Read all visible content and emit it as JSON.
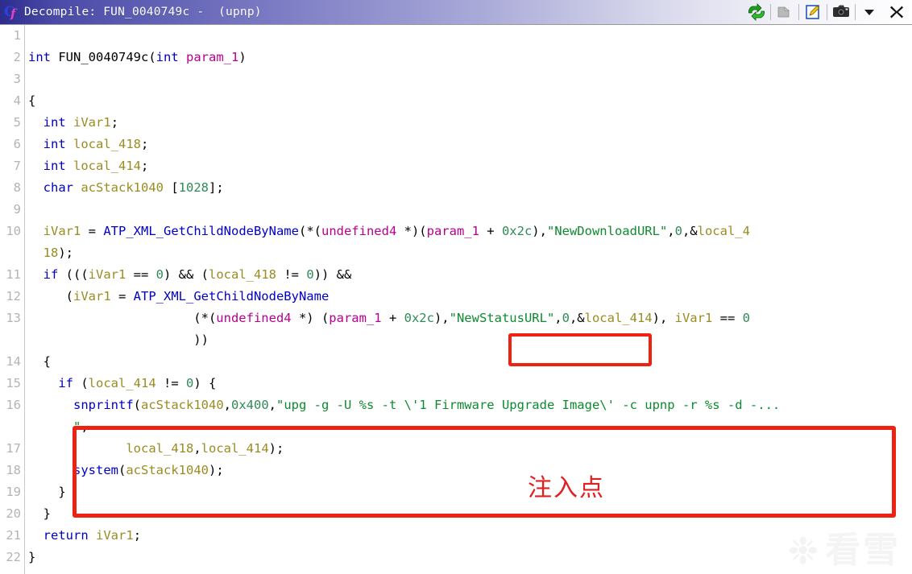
{
  "window": {
    "title": "Decompile: FUN_0040749c -  (upnp)",
    "icon_name": "ghidra-decompiler-icon",
    "toolbar": [
      {
        "name": "refresh-button",
        "label": "Refresh",
        "enabled": true
      },
      {
        "name": "copy-button",
        "label": "Copy",
        "enabled": false
      },
      {
        "name": "edit-button",
        "label": "Edit Function",
        "enabled": true
      },
      {
        "name": "snapshot-button",
        "label": "Snapshot",
        "enabled": true
      },
      {
        "name": "menu-button",
        "label": "Menu",
        "enabled": true
      },
      {
        "name": "close-button",
        "label": "Close",
        "enabled": true
      }
    ]
  },
  "colors": {
    "keyword": "#0000c0",
    "function": "#0000c8",
    "variable": "#9a8c22",
    "parameter": "#b8008f",
    "string": "#0e8a30",
    "number": "#2e8b57",
    "annotation": "#ee2211",
    "gutter_text": "#b4b4b4",
    "titlebar_start": "#2c2c8c",
    "titlebar_end": "#ffffff"
  },
  "code": {
    "lines": [
      {
        "n": "1",
        "tokens": []
      },
      {
        "n": "2",
        "tokens": [
          {
            "t": "int",
            "c": "kw"
          },
          {
            "t": " ",
            "c": "pl"
          },
          {
            "t": "FUN_0040749c",
            "c": "pl"
          },
          {
            "t": "(",
            "c": "pl"
          },
          {
            "t": "int",
            "c": "kw"
          },
          {
            "t": " ",
            "c": "pl"
          },
          {
            "t": "param_1",
            "c": "par"
          },
          {
            "t": ")",
            "c": "pl"
          }
        ]
      },
      {
        "n": "3",
        "tokens": []
      },
      {
        "n": "4",
        "tokens": [
          {
            "t": "{",
            "c": "pl"
          }
        ]
      },
      {
        "n": "5",
        "tokens": [
          {
            "t": "  ",
            "c": "pl"
          },
          {
            "t": "int",
            "c": "kw"
          },
          {
            "t": " ",
            "c": "pl"
          },
          {
            "t": "iVar1",
            "c": "var"
          },
          {
            "t": ";",
            "c": "pl"
          }
        ]
      },
      {
        "n": "6",
        "tokens": [
          {
            "t": "  ",
            "c": "pl"
          },
          {
            "t": "int",
            "c": "kw"
          },
          {
            "t": " ",
            "c": "pl"
          },
          {
            "t": "local_418",
            "c": "var"
          },
          {
            "t": ";",
            "c": "pl"
          }
        ]
      },
      {
        "n": "7",
        "tokens": [
          {
            "t": "  ",
            "c": "pl"
          },
          {
            "t": "int",
            "c": "kw"
          },
          {
            "t": " ",
            "c": "pl"
          },
          {
            "t": "local_414",
            "c": "var"
          },
          {
            "t": ";",
            "c": "pl"
          }
        ]
      },
      {
        "n": "8",
        "tokens": [
          {
            "t": "  ",
            "c": "pl"
          },
          {
            "t": "char",
            "c": "kw"
          },
          {
            "t": " ",
            "c": "pl"
          },
          {
            "t": "acStack1040",
            "c": "var"
          },
          {
            "t": " [",
            "c": "pl"
          },
          {
            "t": "1028",
            "c": "num"
          },
          {
            "t": "];",
            "c": "pl"
          }
        ]
      },
      {
        "n": "9",
        "tokens": []
      },
      {
        "n": "10",
        "tokens": [
          {
            "t": "  ",
            "c": "pl"
          },
          {
            "t": "iVar1",
            "c": "var"
          },
          {
            "t": " = ",
            "c": "pl"
          },
          {
            "t": "ATP_XML_GetChildNodeByName",
            "c": "fn"
          },
          {
            "t": "(*(",
            "c": "pl"
          },
          {
            "t": "undefined4",
            "c": "typ"
          },
          {
            "t": " *)(",
            "c": "pl"
          },
          {
            "t": "param_1",
            "c": "par"
          },
          {
            "t": " + ",
            "c": "pl"
          },
          {
            "t": "0x2c",
            "c": "num"
          },
          {
            "t": "),",
            "c": "pl"
          },
          {
            "t": "\"NewDownloadURL\"",
            "c": "str"
          },
          {
            "t": ",",
            "c": "pl"
          },
          {
            "t": "0",
            "c": "num"
          },
          {
            "t": ",&",
            "c": "pl"
          },
          {
            "t": "local_4",
            "c": "var"
          }
        ]
      },
      {
        "n": "",
        "tokens": [
          {
            "t": "  ",
            "c": "pl"
          },
          {
            "t": "18",
            "c": "var"
          },
          {
            "t": ");",
            "c": "pl"
          }
        ]
      },
      {
        "n": "11",
        "tokens": [
          {
            "t": "  ",
            "c": "pl"
          },
          {
            "t": "if",
            "c": "kw"
          },
          {
            "t": " (((",
            "c": "pl"
          },
          {
            "t": "iVar1",
            "c": "var"
          },
          {
            "t": " == ",
            "c": "pl"
          },
          {
            "t": "0",
            "c": "num"
          },
          {
            "t": ") && (",
            "c": "pl"
          },
          {
            "t": "local_418",
            "c": "var"
          },
          {
            "t": " != ",
            "c": "pl"
          },
          {
            "t": "0",
            "c": "num"
          },
          {
            "t": ")) &&",
            "c": "pl"
          }
        ]
      },
      {
        "n": "12",
        "tokens": [
          {
            "t": "     (",
            "c": "pl"
          },
          {
            "t": "iVar1",
            "c": "var"
          },
          {
            "t": " = ",
            "c": "pl"
          },
          {
            "t": "ATP_XML_GetChildNodeByName",
            "c": "fn"
          }
        ]
      },
      {
        "n": "13",
        "tokens": [
          {
            "t": "                      (*(",
            "c": "pl"
          },
          {
            "t": "undefined4",
            "c": "typ"
          },
          {
            "t": " *) (",
            "c": "pl"
          },
          {
            "t": "param_1",
            "c": "par"
          },
          {
            "t": " + ",
            "c": "pl"
          },
          {
            "t": "0x2c",
            "c": "num"
          },
          {
            "t": "),",
            "c": "pl"
          },
          {
            "t": "\"NewStatusURL\"",
            "c": "str"
          },
          {
            "t": ",",
            "c": "pl"
          },
          {
            "t": "0",
            "c": "num"
          },
          {
            "t": ",&",
            "c": "pl"
          },
          {
            "t": "local_414",
            "c": "var"
          },
          {
            "t": "), ",
            "c": "pl"
          },
          {
            "t": "iVar1",
            "c": "var"
          },
          {
            "t": " == ",
            "c": "pl"
          },
          {
            "t": "0",
            "c": "num"
          }
        ]
      },
      {
        "n": "",
        "tokens": [
          {
            "t": "                      ))",
            "c": "pl"
          }
        ]
      },
      {
        "n": "14",
        "tokens": [
          {
            "t": "  {",
            "c": "pl"
          }
        ]
      },
      {
        "n": "15",
        "tokens": [
          {
            "t": "    ",
            "c": "pl"
          },
          {
            "t": "if",
            "c": "kw"
          },
          {
            "t": " (",
            "c": "pl"
          },
          {
            "t": "local_414",
            "c": "var"
          },
          {
            "t": " != ",
            "c": "pl"
          },
          {
            "t": "0",
            "c": "num"
          },
          {
            "t": ") {",
            "c": "pl"
          }
        ]
      },
      {
        "n": "16",
        "tokens": [
          {
            "t": "      ",
            "c": "pl"
          },
          {
            "t": "snprintf",
            "c": "fn"
          },
          {
            "t": "(",
            "c": "pl"
          },
          {
            "t": "acStack1040",
            "c": "var"
          },
          {
            "t": ",",
            "c": "pl"
          },
          {
            "t": "0x400",
            "c": "num"
          },
          {
            "t": ",",
            "c": "pl"
          },
          {
            "t": "\"upg -g -U %s -t \\'1 Firmware Upgrade Image\\' -c upnp -r %s -d -...",
            "c": "str"
          }
        ]
      },
      {
        "n": "",
        "tokens": [
          {
            "t": "      ",
            "c": "pl"
          },
          {
            "t": "\"",
            "c": "str"
          },
          {
            "t": ",",
            "c": "pl"
          }
        ]
      },
      {
        "n": "17",
        "tokens": [
          {
            "t": "             ",
            "c": "pl"
          },
          {
            "t": "local_418",
            "c": "var"
          },
          {
            "t": ",",
            "c": "pl"
          },
          {
            "t": "local_414",
            "c": "var"
          },
          {
            "t": ");",
            "c": "pl"
          }
        ]
      },
      {
        "n": "18",
        "tokens": [
          {
            "t": "      ",
            "c": "pl"
          },
          {
            "t": "system",
            "c": "fn"
          },
          {
            "t": "(",
            "c": "pl"
          },
          {
            "t": "acStack1040",
            "c": "var"
          },
          {
            "t": ");",
            "c": "pl"
          }
        ]
      },
      {
        "n": "19",
        "tokens": [
          {
            "t": "    }",
            "c": "pl"
          }
        ]
      },
      {
        "n": "20",
        "tokens": [
          {
            "t": "  }",
            "c": "pl"
          }
        ]
      },
      {
        "n": "21",
        "tokens": [
          {
            "t": "  ",
            "c": "pl"
          },
          {
            "t": "return",
            "c": "kw"
          },
          {
            "t": " ",
            "c": "pl"
          },
          {
            "t": "iVar1",
            "c": "var"
          },
          {
            "t": ";",
            "c": "pl"
          }
        ]
      },
      {
        "n": "22",
        "tokens": [
          {
            "t": "}",
            "c": "pl"
          }
        ]
      }
    ]
  },
  "annotations": {
    "status_url_box": {
      "name": "highlight-box-newstatusurl"
    },
    "injection_box": {
      "name": "highlight-box-injection-point"
    },
    "injection_label": "注入点"
  },
  "watermark": {
    "glyph": "❉",
    "text": "看雪"
  }
}
